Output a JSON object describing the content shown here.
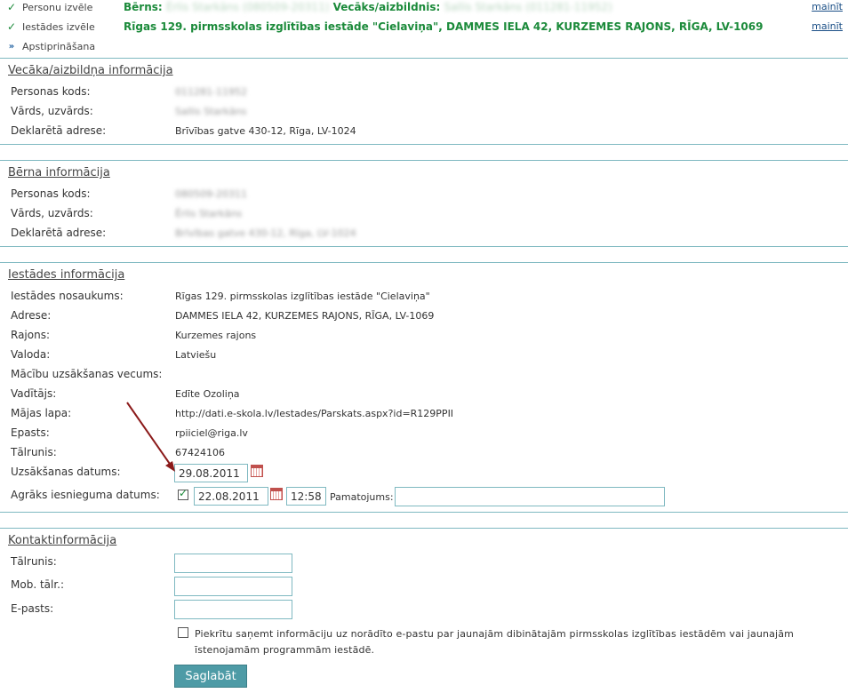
{
  "steps": [
    {
      "name": "Personu izvēle",
      "mark": "✓",
      "detail_parts": {
        "child_label": "Bērns:",
        "child_value": "Ērlis Starkāns (080509-20311)",
        "parent_label": "Vecāks/aizbildnis:",
        "parent_value": "Sallis Starkāns (011281-11952)"
      },
      "change": "mainīt"
    },
    {
      "name": "Iestādes izvēle",
      "mark": "✓",
      "detail": "Rīgas 129. pirmsskolas izglītības iestāde \"Cielaviņa\", DAMMES IELA 42, KURZEMES RAJONS, RĪGA, LV-1069",
      "change": "mainīt"
    },
    {
      "name": "Apstiprināšana",
      "mark": "»"
    }
  ],
  "parent_info": {
    "title": "Vecāka/aizbildņa informācija",
    "rows": [
      {
        "label": "Personas kods:",
        "value": "011281-11952",
        "blurred": true
      },
      {
        "label": "Vārds, uzvārds:",
        "value": "Sallis Starkāns",
        "blurred": true
      },
      {
        "label": "Deklarētā adrese:",
        "value": "Brīvības gatve 430-12, Rīga, LV-1024",
        "blurred": false
      }
    ]
  },
  "child_info": {
    "title": "Bērna informācija",
    "rows": [
      {
        "label": "Personas kods:",
        "value": "080509-20311",
        "blurred": true
      },
      {
        "label": "Vārds, uzvārds:",
        "value": "Ērlis Starkāns",
        "blurred": true
      },
      {
        "label": "Deklarētā adrese:",
        "value": "Brīvības gatve 430-12, Rīga, LV-1024",
        "blurred": true
      }
    ]
  },
  "institution": {
    "title": "Iestādes informācija",
    "rows": [
      {
        "label": "Iestādes nosaukums:",
        "value": "Rīgas 129. pirmsskolas izglītības iestāde \"Cielaviņa\""
      },
      {
        "label": "Adrese:",
        "value": "DAMMES IELA 42, KURZEMES RAJONS, RĪGA, LV-1069"
      },
      {
        "label": "Rajons:",
        "value": "Kurzemes rajons"
      },
      {
        "label": "Valoda:",
        "value": "Latviešu"
      },
      {
        "label": "Mācību uzsākšanas vecums:",
        "value": ""
      },
      {
        "label": "Vadītājs:",
        "value": "Edīte Ozoliņa"
      },
      {
        "label": "Mājas lapa:",
        "value": "http://dati.e-skola.lv/Iestades/Parskats.aspx?id=R129PPII"
      },
      {
        "label": "Epasts:",
        "value": "rpiiciel@riga.lv"
      },
      {
        "label": "Tālrunis:",
        "value": "67424106"
      }
    ],
    "start_date": {
      "label": "Uzsākšanas datums:",
      "value": "29.08.2011",
      "calendar_icon": "calendar-icon"
    },
    "early_date": {
      "label": "Agrāks iesnieguma datums:",
      "checked": true,
      "date": "22.08.2011",
      "time": "12:58",
      "reason_label": "Pamatojums:",
      "reason_value": ""
    }
  },
  "contact": {
    "title": "Kontaktinformācija",
    "rows": [
      {
        "label": "Tālrunis:",
        "value": ""
      },
      {
        "label": "Mob. tālr.:",
        "value": ""
      },
      {
        "label": "E-pasts:",
        "value": ""
      }
    ],
    "agree_checked": false,
    "agree_text": "Piekrītu saņemt informāciju uz norādīto e-pastu par jaunajām dibinātajām pirmsskolas izglītības iestādēm vai jaunajām īstenojamām programmām iestādē."
  },
  "save_label": "Saglabāt",
  "colors": {
    "accent": "#4e9ba6",
    "line": "#7fb9c1",
    "success": "#1b8a3a",
    "link": "#1b4f86",
    "annotation_arrow": "#8b1a1a"
  }
}
